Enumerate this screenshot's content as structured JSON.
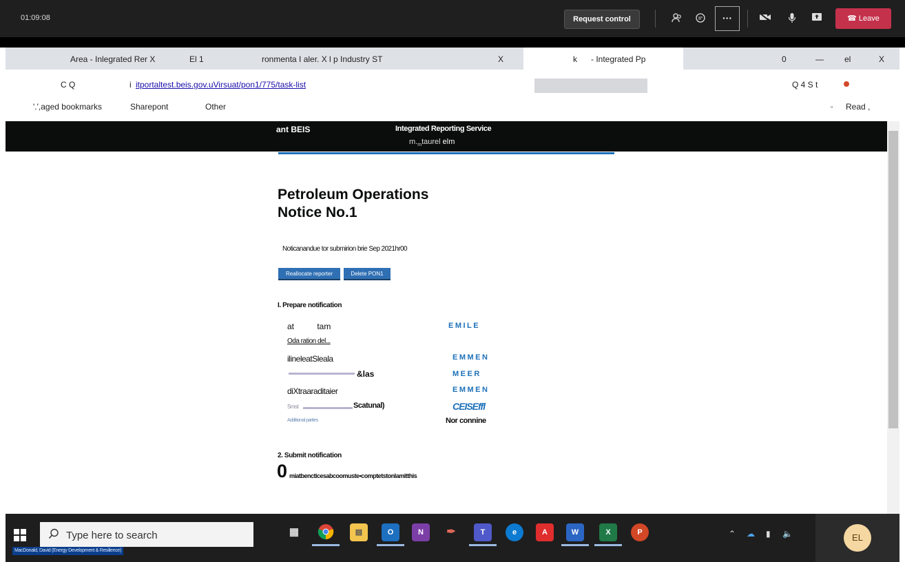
{
  "meeting": {
    "timer": "01:09:08",
    "request_control": "Request control",
    "more": "···",
    "leave": "Leave"
  },
  "browser": {
    "tabs": [
      "Area - Inlegrated Rer X",
      "El 1",
      "ronmenta I aler. X l p Industry ST",
      "X",
      "k",
      "- Integrated Pp",
      "0",
      "—",
      "el",
      "X"
    ],
    "nav": "C Q",
    "url_prefix": "i",
    "url": "itportaltest.beis.gov.uVirsuat/pon1/775/task-list",
    "right_icons": "Q 4  S t",
    "bookmarks": {
      "managed": "'.',aged bookmarks",
      "sharepoint": "Sharepont",
      "other": "Other",
      "read_icon": "▫",
      "read": "Read ,"
    }
  },
  "site": {
    "brand": "ant BEIS",
    "service": "Integrated Reporting Service",
    "user_sub": "m.",
    "user_sub2": "m",
    "user_a": "taurel",
    "user_b": "elm"
  },
  "main": {
    "title_line1": "Petroleum Operations",
    "title_line2": "Notice No.1",
    "due": "Noticanandue tor submirion brie Sep 2021hr00",
    "btn_reallocate": "Reallocate reporter",
    "btn_delete": "Delete PON1",
    "section1": "I. Prepare notification",
    "tasks": [
      {
        "name": "at          tam",
        "status": "EMILE"
      },
      {
        "name": "Oda ration del...",
        "status": ""
      },
      {
        "name": "ilineleatSleala",
        "status": "EMMEN"
      },
      {
        "name": "&las",
        "status": "MEER"
      },
      {
        "name": "diXtraaraditaier",
        "status": "EMMEN"
      },
      {
        "name": "Smst",
        "extra": "Scatunal)",
        "status": "CEISEffl"
      },
      {
        "name": "Additional parties",
        "status": "Nor connine"
      }
    ],
    "section2": "2. Submit notification",
    "zero": "0",
    "submit_text": "miatbencticesabcoomuste•comptetstonlamitthis"
  },
  "taskbar": {
    "search_placeholder": "Type here to search",
    "avatar": "EL",
    "caption": "MacDonald, David (Energy Development & Resilience)"
  }
}
